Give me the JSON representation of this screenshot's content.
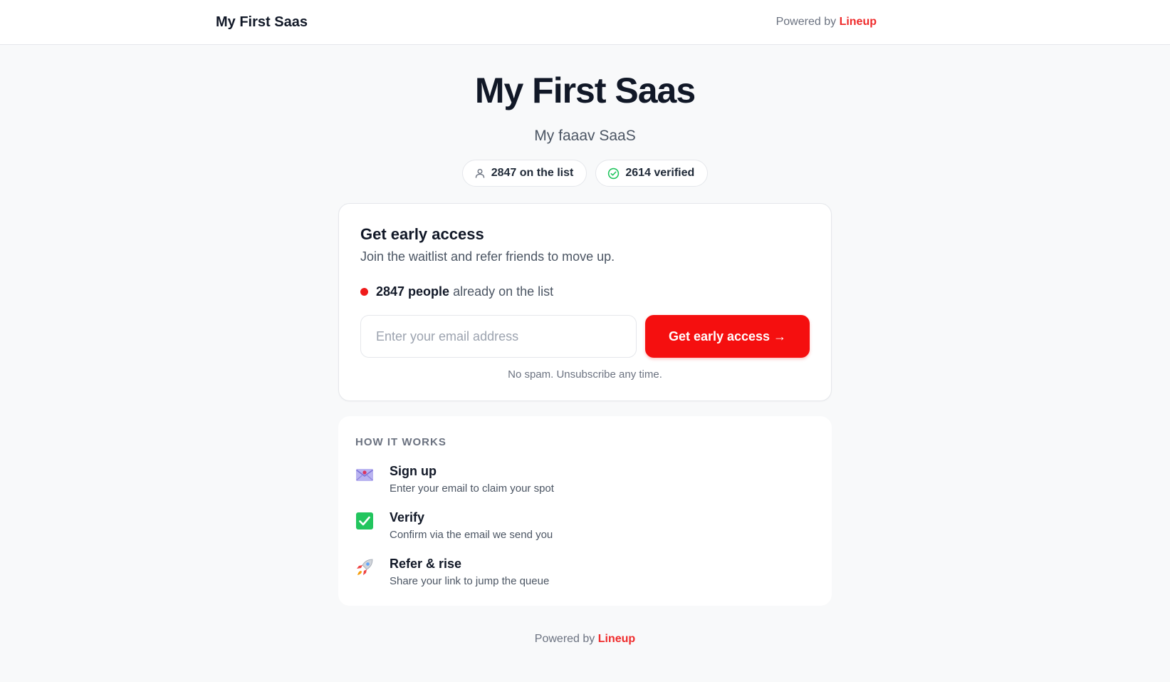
{
  "header": {
    "brand": "My First Saas",
    "powered_prefix": "Powered by",
    "powered_brand": "Lineup"
  },
  "hero": {
    "title": "My First Saas",
    "tagline": "My faaav SaaS"
  },
  "stats": [
    {
      "icon": "user-icon",
      "label": "2847 on the list"
    },
    {
      "icon": "check-circle-icon",
      "label": "2614 verified"
    }
  ],
  "signup": {
    "title": "Get early access",
    "subtitle": "Join the waitlist and refer friends to move up.",
    "count_strong": "2847 people",
    "count_rest": "already on the list",
    "email_placeholder": "Enter your email address",
    "email_value": "",
    "button_label": "Get early access →",
    "note": "No spam. Unsubscribe any time."
  },
  "how_it_works": {
    "title": "HOW IT WORKS",
    "steps": [
      {
        "icon": "envelope-icon",
        "title": "Sign up",
        "desc": "Enter your email to claim your spot"
      },
      {
        "icon": "checkbox-icon",
        "title": "Verify",
        "desc": "Confirm via the email we send you"
      },
      {
        "icon": "rocket-icon",
        "title": "Refer & rise",
        "desc": "Share your link to jump the queue"
      }
    ]
  },
  "footer": {
    "powered_prefix": "Powered by",
    "powered_brand": "Lineup"
  },
  "colors": {
    "accent": "#f50f0f",
    "brand_text": "#ef2b2b",
    "success": "#22c55e"
  }
}
